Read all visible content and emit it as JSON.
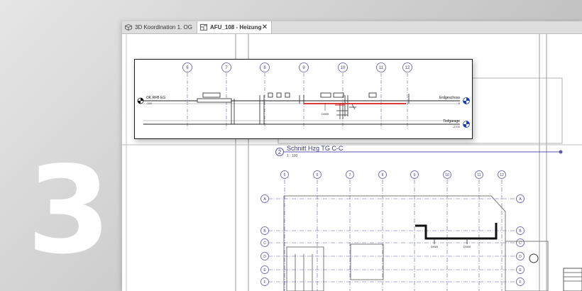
{
  "hero": {
    "number": "3"
  },
  "tabs": [
    {
      "label": "3D Koordination 1. OG",
      "icon": "cube-icon",
      "active": false
    },
    {
      "label": "AFU_108 - Heizung",
      "icon": "floor-plan-icon",
      "active": true,
      "close": "✕"
    }
  ],
  "section_view": {
    "title": "Schnitt Hzg TG C-C",
    "scale": "1 : 100",
    "marker": "2",
    "grid_labels": [
      "6",
      "7",
      "8",
      "9",
      "10",
      "11",
      "12"
    ],
    "levels_left": [
      {
        "name": "OK RFB EG",
        "value": "-150"
      }
    ],
    "levels_right": [
      {
        "name": "Erdgeschoss",
        "value": "0"
      },
      {
        "name": "Tiefgarage",
        "value": "-2700"
      }
    ],
    "tag": "DN65"
  },
  "plan_view": {
    "grid_columns": [
      "5",
      "6",
      "7",
      "8",
      "9",
      "10",
      "11",
      "12"
    ],
    "grid_rows": [
      "A",
      "A",
      "B",
      "C",
      "D",
      "E",
      "F"
    ],
    "pipe_tags": [
      "DN65",
      "DN65"
    ]
  },
  "colors": {
    "grid": "#5a5aa8",
    "pipe_hot": "#d62020",
    "linework": "#222222"
  }
}
